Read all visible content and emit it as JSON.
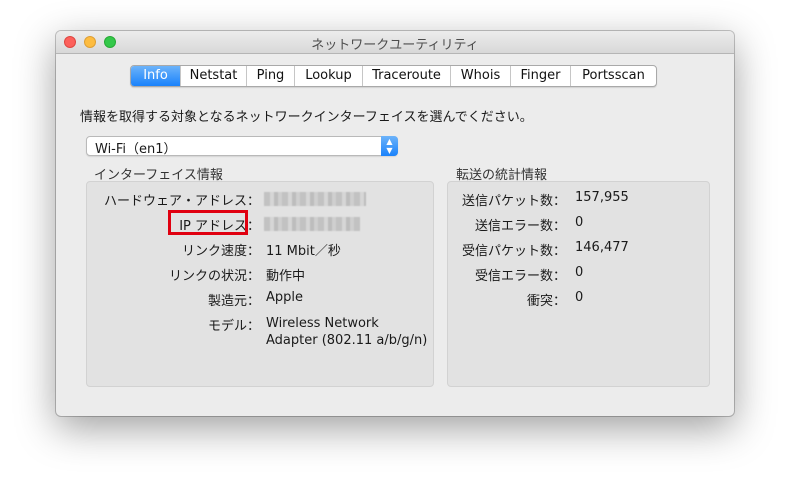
{
  "window": {
    "title": "ネットワークユーティリティ"
  },
  "tabs": [
    {
      "label": "Info",
      "active": true
    },
    {
      "label": "Netstat",
      "active": false
    },
    {
      "label": "Ping",
      "active": false
    },
    {
      "label": "Lookup",
      "active": false
    },
    {
      "label": "Traceroute",
      "active": false
    },
    {
      "label": "Whois",
      "active": false
    },
    {
      "label": "Finger",
      "active": false
    },
    {
      "label": "Portsscan",
      "active": false
    }
  ],
  "instruction": "情報を取得する対象となるネットワークインターフェイスを選んでください。",
  "interface_select": {
    "value": "Wi-Fi（en1）"
  },
  "interface_info": {
    "heading": "インターフェイス情報",
    "hardware_address_label": "ハードウェア・アドレス：",
    "ip_address_label": "IP アドレス：",
    "link_speed_label": "リンク速度：",
    "link_speed_value": "11 Mbit／秒",
    "link_status_label": "リンクの状況：",
    "link_status_value": "動作中",
    "vendor_label": "製造元：",
    "vendor_value": "Apple",
    "model_label": "モデル：",
    "model_value_line1": "Wireless Network",
    "model_value_line2": "Adapter (802.11 a/b/g/n)"
  },
  "transfer_stats": {
    "heading": "転送の統計情報",
    "sent_packets_label": "送信パケット数：",
    "sent_packets_value": "157,955",
    "send_errors_label": "送信エラー数：",
    "send_errors_value": "0",
    "received_packets_label": "受信パケット数：",
    "received_packets_value": "146,477",
    "receive_errors_label": "受信エラー数：",
    "receive_errors_value": "0",
    "collisions_label": "衝突：",
    "collisions_value": "0"
  },
  "colors": {
    "highlight_border": "#e00010",
    "accent_blue": "#1a82fb"
  }
}
